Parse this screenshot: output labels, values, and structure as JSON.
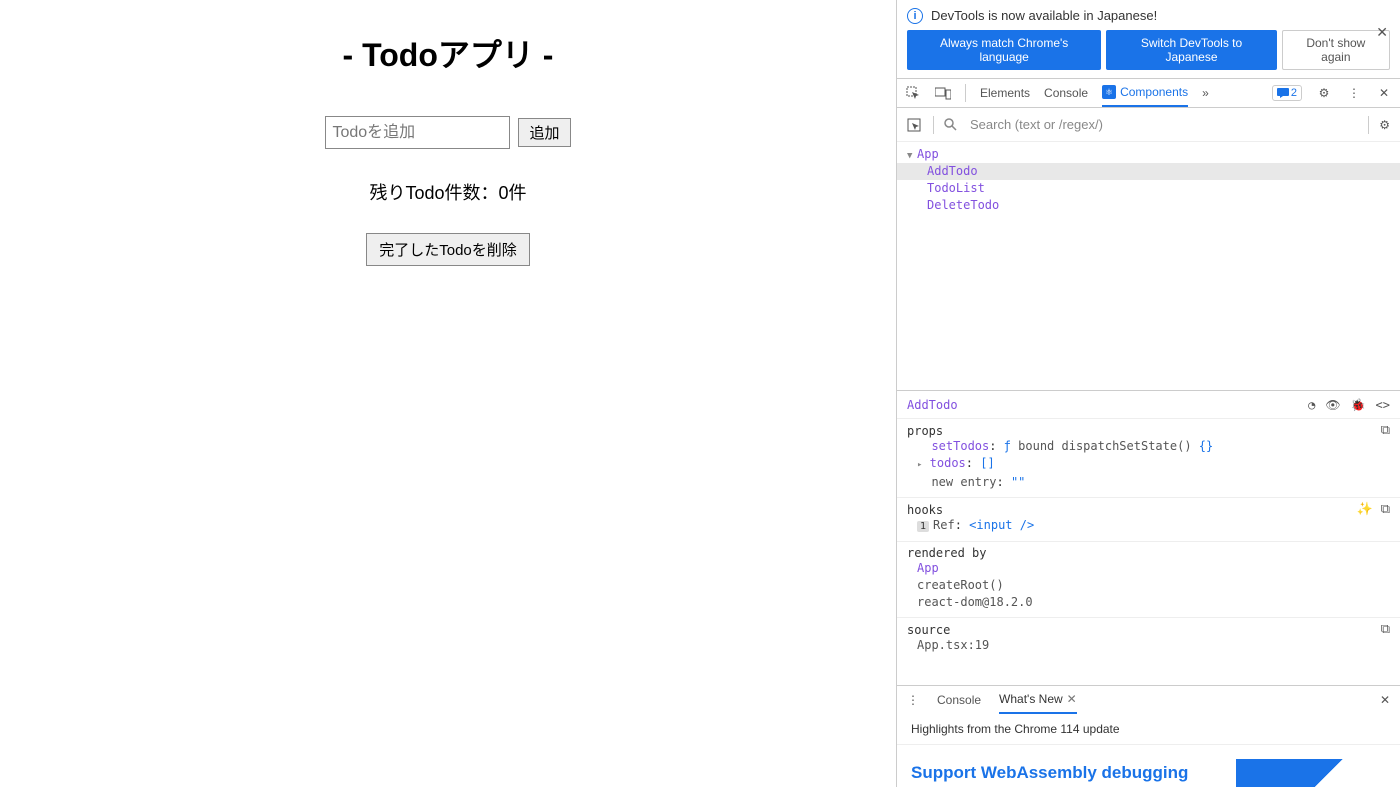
{
  "app": {
    "title": "- Todoアプリ -",
    "input_placeholder": "Todoを追加",
    "add_button": "追加",
    "remaining_label": "残りTodo件数：0件",
    "delete_button": "完了したTodoを削除"
  },
  "devtools": {
    "info": {
      "text": "DevTools is now available in Japanese!",
      "always_match": "Always match Chrome's language",
      "switch_to": "Switch DevTools to Japanese",
      "dont_show": "Don't show again"
    },
    "tabs": {
      "elements": "Elements",
      "console": "Console",
      "components": "Components",
      "more": "»",
      "msg_count": "2"
    },
    "search_placeholder": "Search (text or /regex/)",
    "tree": {
      "root": "App",
      "children": [
        "AddTodo",
        "TodoList",
        "DeleteTodo"
      ]
    },
    "details": {
      "component": "AddTodo",
      "props_label": "props",
      "props": {
        "setTodos_key": "setTodos",
        "setTodos_val_f": "ƒ ",
        "setTodos_val_name": "bound dispatchSetState()",
        "setTodos_val_braces": " {}",
        "todos_key": "todos",
        "todos_val": "[]",
        "new_entry_label": "new entry",
        "new_entry_val": "\"\""
      },
      "hooks_label": "hooks",
      "hooks": {
        "badge": "1",
        "ref_label": "Ref",
        "ref_val": "<input />"
      },
      "rendered_label": "rendered by",
      "rendered": {
        "app": "App",
        "createRoot": "createRoot()",
        "reactdom": "react-dom@18.2.0"
      },
      "source_label": "source",
      "source_val": "App.tsx:19"
    },
    "drawer": {
      "console": "Console",
      "whatsnew": "What's New",
      "highlights": "Highlights from the Chrome 114 update",
      "wasm": "Support WebAssembly debugging"
    }
  }
}
